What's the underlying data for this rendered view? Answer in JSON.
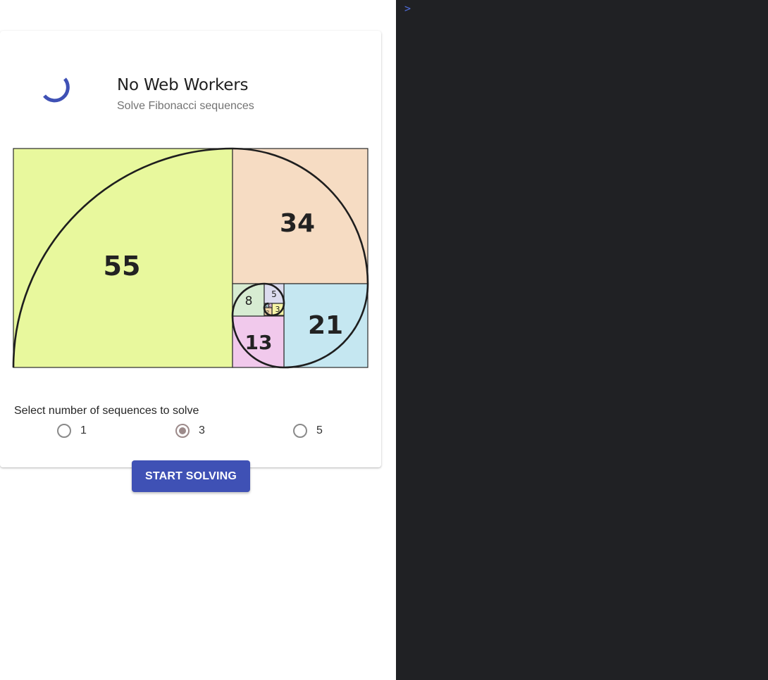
{
  "card": {
    "title": "No Web Workers",
    "subtitle": "Solve Fibonacci sequences"
  },
  "fibonacci_image": {
    "numbers": [
      "55",
      "34",
      "21",
      "13",
      "8",
      "5",
      "3",
      "2",
      "1",
      "1"
    ],
    "colors": {
      "55": "#e8f89d",
      "34": "#f6dcc3",
      "21": "#c5e7f1",
      "13": "#f1c9ec",
      "8": "#d7ecd2",
      "5": "#dcdcef",
      "3": "#f6f5a7"
    }
  },
  "form": {
    "label": "Select number of sequences to solve",
    "options": [
      {
        "label": "1",
        "checked": false
      },
      {
        "label": "3",
        "checked": true
      },
      {
        "label": "5",
        "checked": false
      }
    ],
    "button_label": "START SOLVING"
  },
  "console": {
    "prompt": ">"
  },
  "colors": {
    "accent": "#3f51b5",
    "console_bg": "#202124"
  }
}
